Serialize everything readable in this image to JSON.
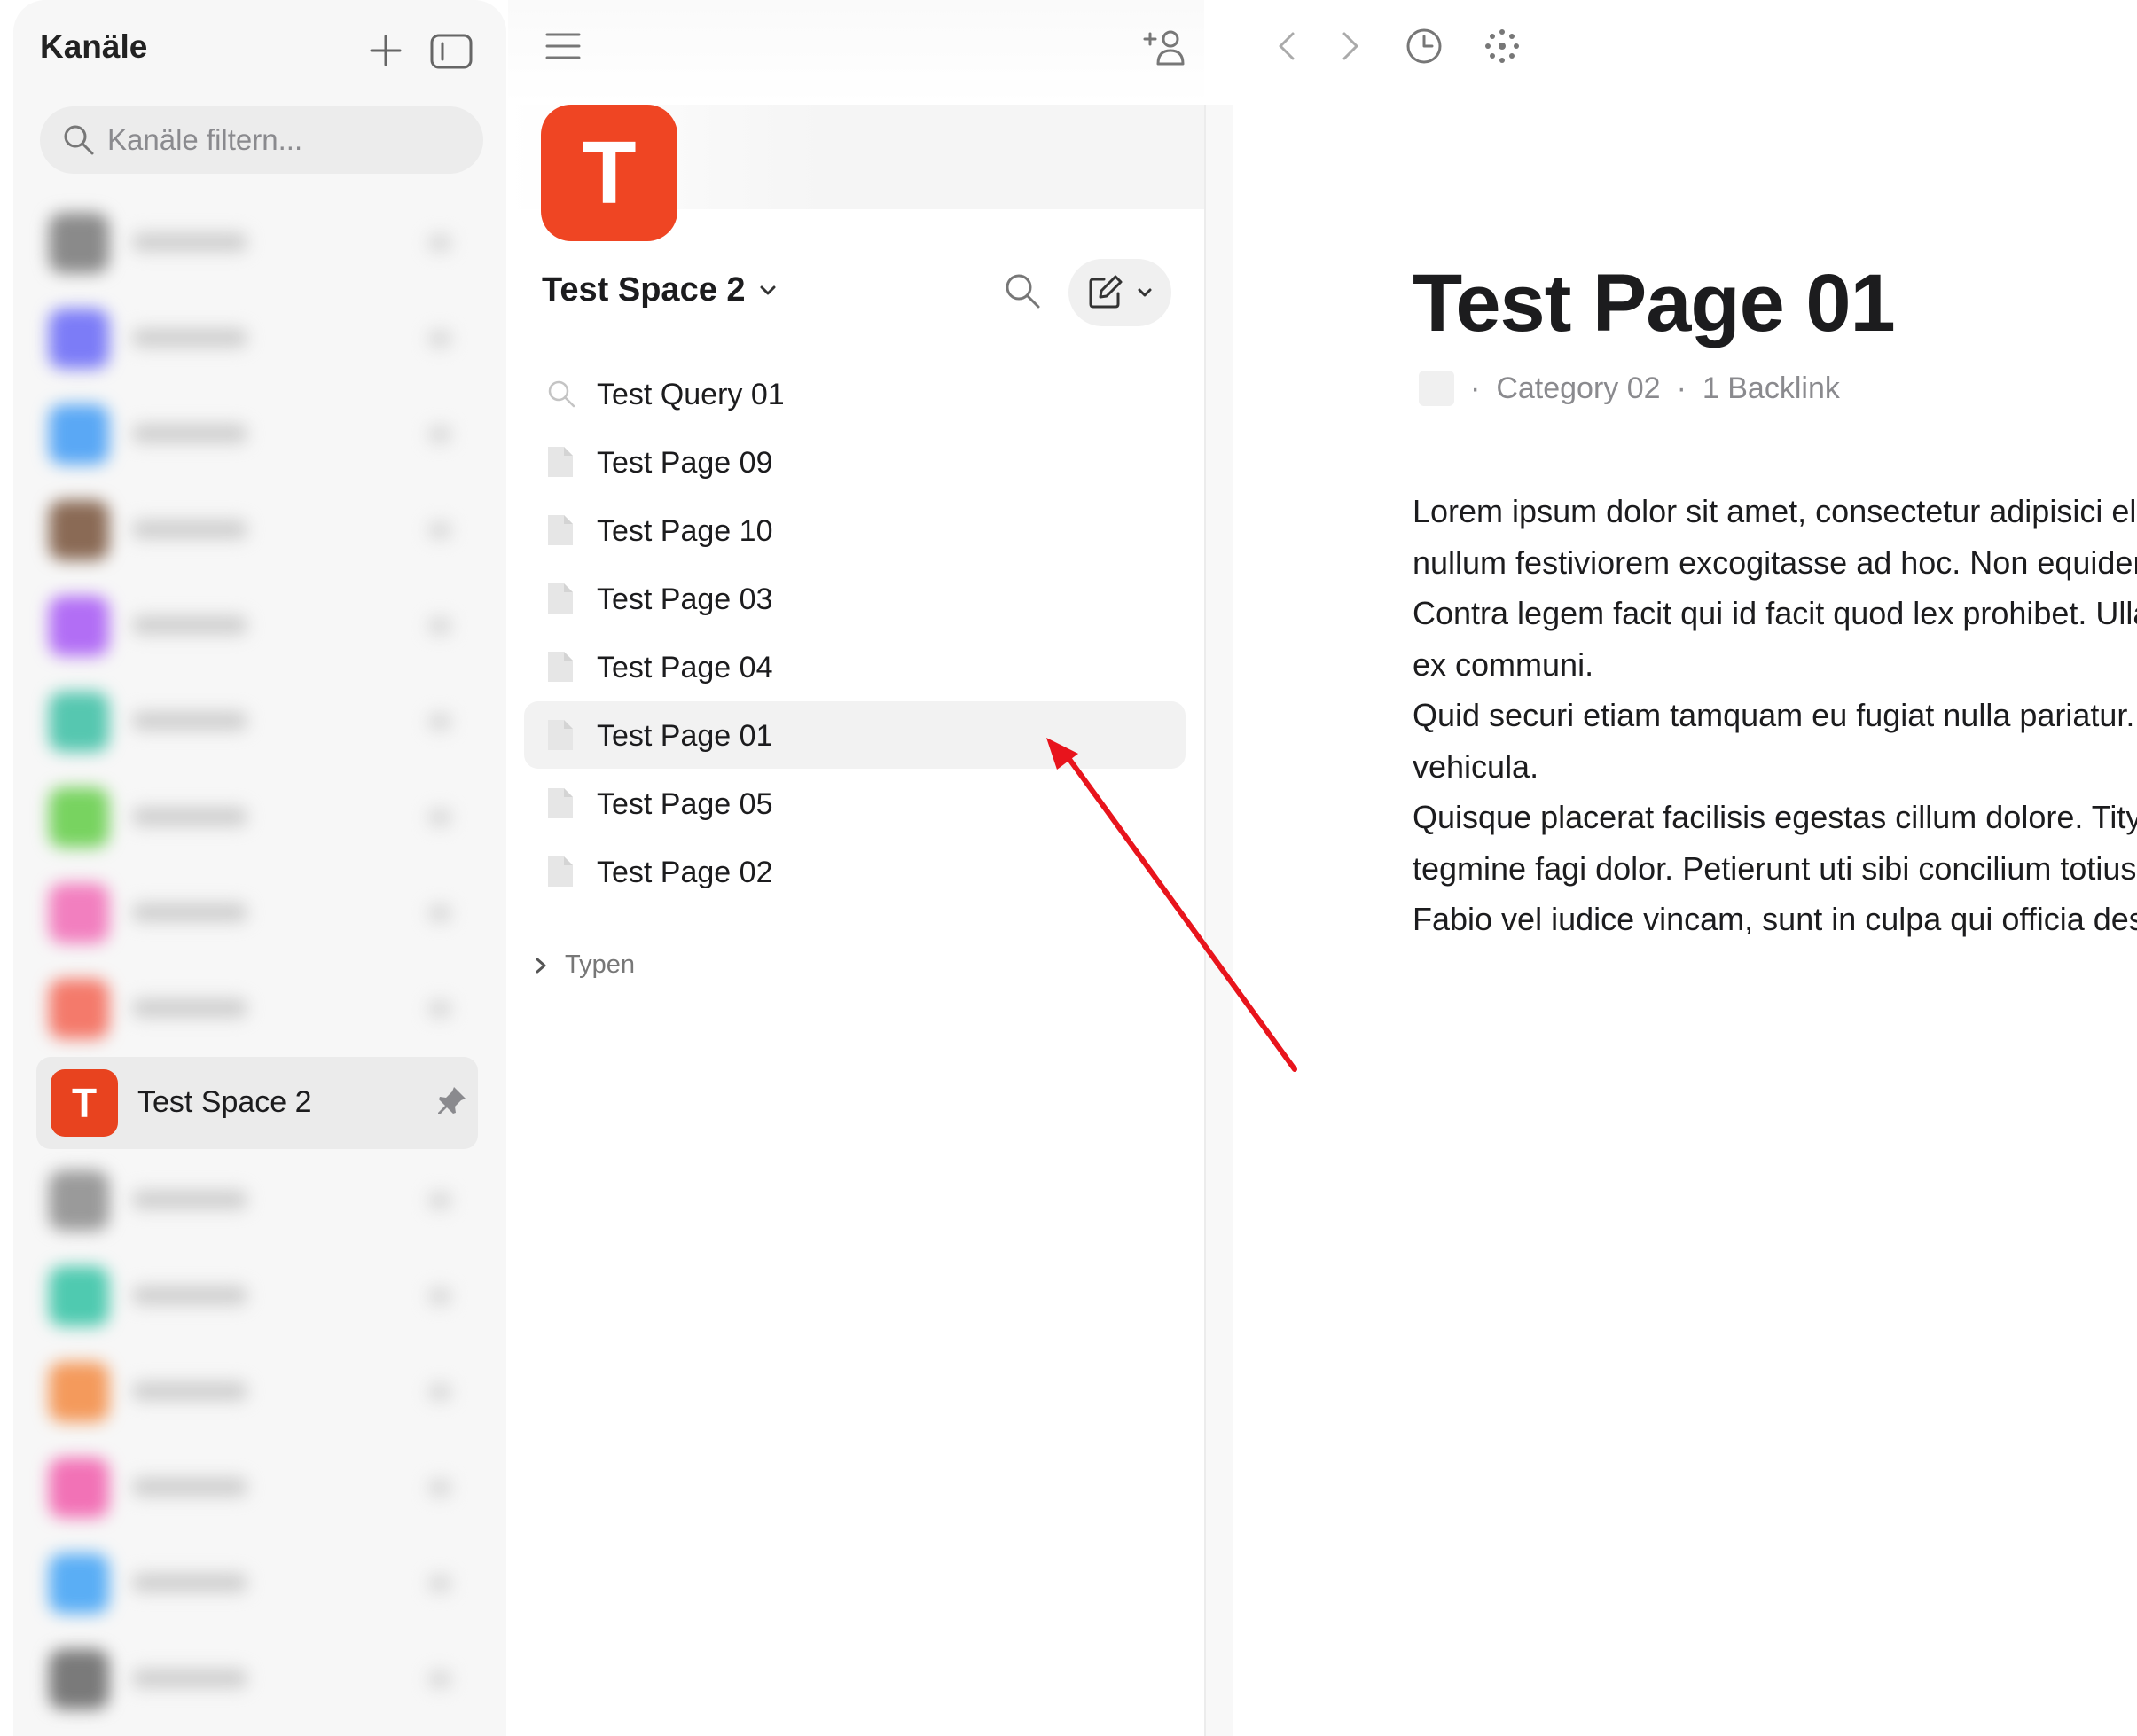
{
  "sidebar": {
    "title": "Kanäle",
    "search_placeholder": "Kanäle filtern...",
    "active_channel": {
      "name": "Test Space 2",
      "initial": "T"
    },
    "blurred_channel_colors": [
      "#8a8a8a",
      "#7c7cf7",
      "#5aa8f5",
      "#8a6a55",
      "#b26ef5",
      "#56c7b0",
      "#78d360",
      "#f27fbf",
      "#f47a6b"
    ],
    "blurred_channel_colors_after": [
      "#9a9a9a",
      "#4fcab0",
      "#f49a5c",
      "#f272b6",
      "#5aaef5",
      "#7a7a7a"
    ]
  },
  "middle": {
    "space_initial": "T",
    "space_name": "Test Space 2",
    "items": [
      {
        "label": "Test Query 01",
        "icon": "search-icon"
      },
      {
        "label": "Test Page 09",
        "icon": "page-icon"
      },
      {
        "label": "Test Page 10",
        "icon": "page-icon"
      },
      {
        "label": "Test Page 03",
        "icon": "page-icon"
      },
      {
        "label": "Test Page 04",
        "icon": "page-icon"
      },
      {
        "label": "Test Page 01",
        "icon": "page-icon",
        "selected": true
      },
      {
        "label": "Test Page 05",
        "icon": "page-icon"
      },
      {
        "label": "Test Page 02",
        "icon": "page-icon"
      }
    ],
    "types_label": "Typen"
  },
  "document": {
    "title": "Test Page 01",
    "category": "Category 02",
    "backlinks": "1 Backlink",
    "separator": "·",
    "body": [
      "Lorem ipsum dolor sit amet, consectetur adipisici elit, sed eiusmod tempor incidunt.",
      "nullum festiviorem excogitasse ad hoc. Non equidem invideo, miror magis posuere velit.",
      "Contra legem facit qui id facit quod lex prohibet. Ullamco laboris nisi ut aliquid",
      "ex communi.",
      "Quid securi etiam tamquam eu fugiat nulla pariatur. Curabitur est gravida et libero",
      "vehicula.",
      "Quisque placerat facilisis egestas cillum dolore. Tityre, tu patulae recubans sub",
      "tegmine fagi dolor. Petierunt uti sibi concilium totius Galliae in diem certam indicere.",
      "Fabio vel iudice vincam, sunt in culpa qui officia deserunt mollit anim id est laborum."
    ]
  },
  "colors": {
    "accent_red": "#ef4523",
    "arrow_red": "#e8141c",
    "sidebar_bg": "#f7f7f7"
  }
}
